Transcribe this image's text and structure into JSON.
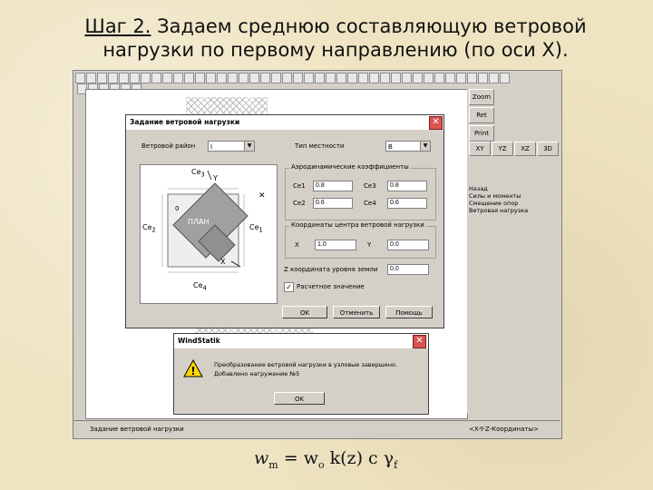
{
  "slide": {
    "title_prefix": "Шаг 2.",
    "title_line1": " Задаем среднюю составляющую ветровой",
    "title_line2": "нагрузки по первому направлению (по оси X)."
  },
  "app": {
    "right_buttons": [
      "Zoom",
      "Ret",
      "Print"
    ],
    "view_buttons": [
      "XY",
      "YZ",
      "XZ",
      "3D"
    ],
    "menu_items": [
      "Назад",
      "Силы и моменты",
      "Смещение опор",
      "Ветровая нагрузка"
    ],
    "status_left": "Задание ветровой нагрузки",
    "status_right": "<X-Y-Z-Координаты>"
  },
  "wind_dialog": {
    "title": "Задание ветровой нагрузки",
    "region_label": "Ветровой район",
    "region_value": "I",
    "terrain_label": "Тип местности",
    "terrain_value": "B",
    "aero_group_label": "Аэродинамические коэффициенты",
    "ce1_label": "Се1",
    "ce1_value": "0.8",
    "ce3_label": "Се3",
    "ce3_value": "0.8",
    "ce2_label": "Се2",
    "ce2_value": "0.6",
    "ce4_label": "Се4",
    "ce4_value": "0.6",
    "coord_group_label": "Координаты центра ветровой нагрузки",
    "x_label": "X",
    "x_value": "1.0",
    "y_label": "Y",
    "y_value": "0.0",
    "z_label": "Z координата уровня земли",
    "z_value": "0.0",
    "checkbox_label": "Расчетное значение",
    "checkbox_mark": "✓",
    "ok_label": "OK",
    "cancel_label": "Отменить",
    "help_label": "Помощь",
    "plan": {
      "label": "ПЛАН",
      "ce1": "Се",
      "ce1_sub": "1",
      "ce2": "Се",
      "ce2_sub": "2",
      "ce3": "Се",
      "ce3_sub": "3",
      "ce4": "Се",
      "ce4_sub": "4",
      "axis_y": "Y",
      "axis_x": "X",
      "zero": "0"
    }
  },
  "msg_dialog": {
    "title": "WindStatik",
    "line1": "Преобразование ветровой нагрузки в узловые завершено.",
    "line2": "Добавлено нагружение №5",
    "ok_label": "OK"
  },
  "formula": {
    "w": "w",
    "w_sub": "m",
    "eq": " = w",
    "w0_sub": "o",
    "rest": " k(z) c γ",
    "gamma_sub": "f"
  }
}
